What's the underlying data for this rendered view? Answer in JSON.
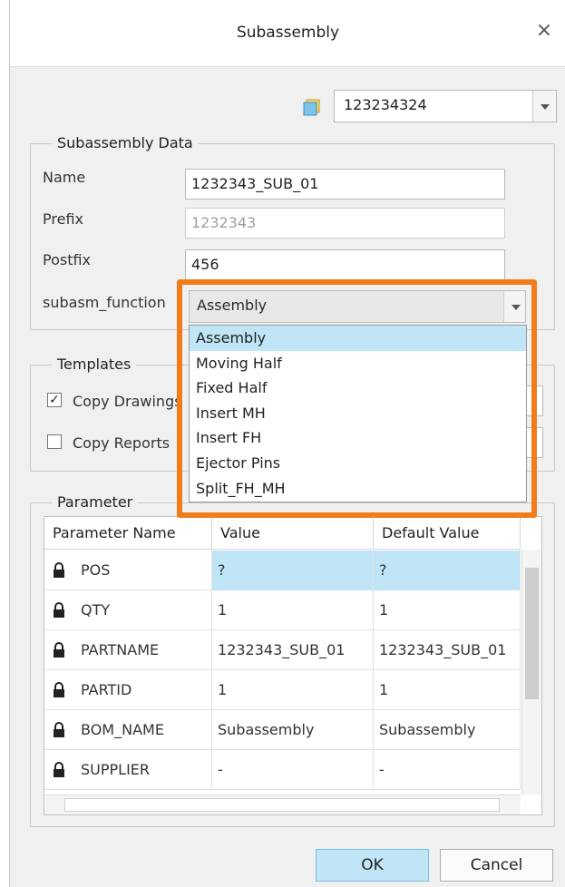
{
  "dialog": {
    "title": "Subassembly",
    "close_glyph": "×",
    "close_icon": "close-icon"
  },
  "top_selector": {
    "icon": "part-icon",
    "value": "123234324"
  },
  "subassembly_data": {
    "group_title": "Subassembly Data",
    "name_label": "Name",
    "name_value": "1232343_SUB_01",
    "prefix_label": "Prefix",
    "prefix_value": "1232343",
    "postfix_label": "Postfix",
    "postfix_value": "456",
    "function_label": "subasm_function",
    "function_value": "Assembly",
    "function_options": [
      "Assembly",
      "Moving Half",
      "Fixed Half",
      "Insert MH",
      "Insert FH",
      "Ejector Pins",
      "Split_FH_MH"
    ]
  },
  "templates": {
    "group_title": "Templates",
    "copy_drawings_label": "Copy Drawings",
    "copy_drawings_checked": true,
    "copy_reports_label": "Copy Reports",
    "copy_reports_checked": false
  },
  "parameter": {
    "group_title": "Parameter",
    "columns": [
      "Parameter Name",
      "Value",
      "Default Value"
    ],
    "rows": [
      {
        "name": "POS",
        "value": "?",
        "default": "?"
      },
      {
        "name": "QTY",
        "value": "1",
        "default": "1"
      },
      {
        "name": "PARTNAME",
        "value": "1232343_SUB_01",
        "default": "1232343_SUB_01"
      },
      {
        "name": "PARTID",
        "value": "1",
        "default": "1"
      },
      {
        "name": "BOM_NAME",
        "value": "Subassembly",
        "default": "Subassembly"
      },
      {
        "name": "SUPPLIER",
        "value": "-",
        "default": "-"
      }
    ],
    "row_icon": "lock-icon"
  },
  "buttons": {
    "ok_label": "OK",
    "cancel_label": "Cancel"
  },
  "colors": {
    "accent_highlight": "#f07c1c",
    "selection": "#bfe5f6"
  }
}
